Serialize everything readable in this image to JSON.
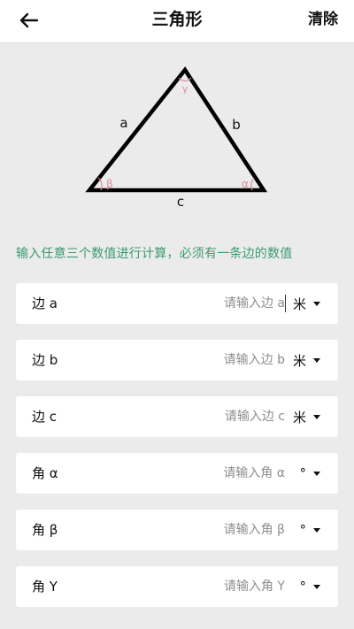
{
  "header": {
    "title": "三角形",
    "clear_label": "清除"
  },
  "figure": {
    "side_a": "a",
    "side_b": "b",
    "side_c": "c",
    "angle_alpha": "α",
    "angle_beta": "β",
    "angle_gamma": "γ"
  },
  "hint": "输入任意三个数值进行计算，必须有一条边的数值",
  "rows": [
    {
      "label": "边 a",
      "placeholder": "请输入边 a",
      "unit": "米"
    },
    {
      "label": "边 b",
      "placeholder": "请输入边 b",
      "unit": "米"
    },
    {
      "label": "边 c",
      "placeholder": "请输入边 c",
      "unit": "米"
    },
    {
      "label": "角 α",
      "placeholder": "请输入角 α",
      "unit": "°"
    },
    {
      "label": "角 β",
      "placeholder": "请输入角 β",
      "unit": "°"
    },
    {
      "label": "角 Y",
      "placeholder": "请输入角 Y",
      "unit": "°"
    }
  ],
  "colors": {
    "hint": "#3a9a6e",
    "angle_label": "#e08a9a",
    "triangle_stroke": "#000000"
  },
  "icons": {
    "back": "arrow-left-icon",
    "dropdown": "caret-down-icon"
  }
}
